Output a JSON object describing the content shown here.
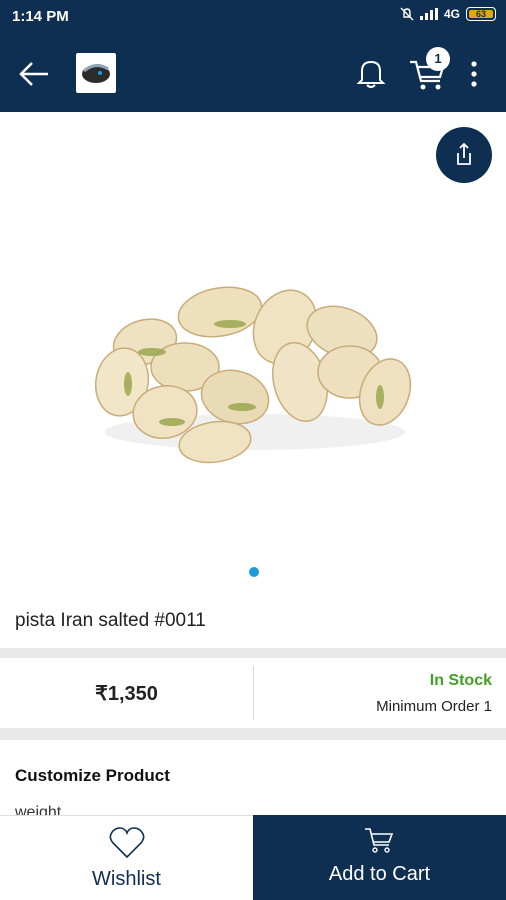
{
  "status_bar": {
    "time": "1:14 PM",
    "network": "4G",
    "battery": "63"
  },
  "app_bar": {
    "cart_count": "1"
  },
  "product": {
    "title": "pista Iran salted #0011",
    "price": "₹1,350",
    "stock_status": "In Stock",
    "minimum_order": "Minimum Order 1"
  },
  "customize": {
    "title": "Customize Product",
    "field_label": "weight"
  },
  "bottom_bar": {
    "wishlist_label": "Wishlist",
    "add_to_cart_label": "Add to Cart"
  },
  "colors": {
    "primary": "#0f2f52",
    "in_stock": "#43a024",
    "indicator": "#1a9ad8"
  }
}
